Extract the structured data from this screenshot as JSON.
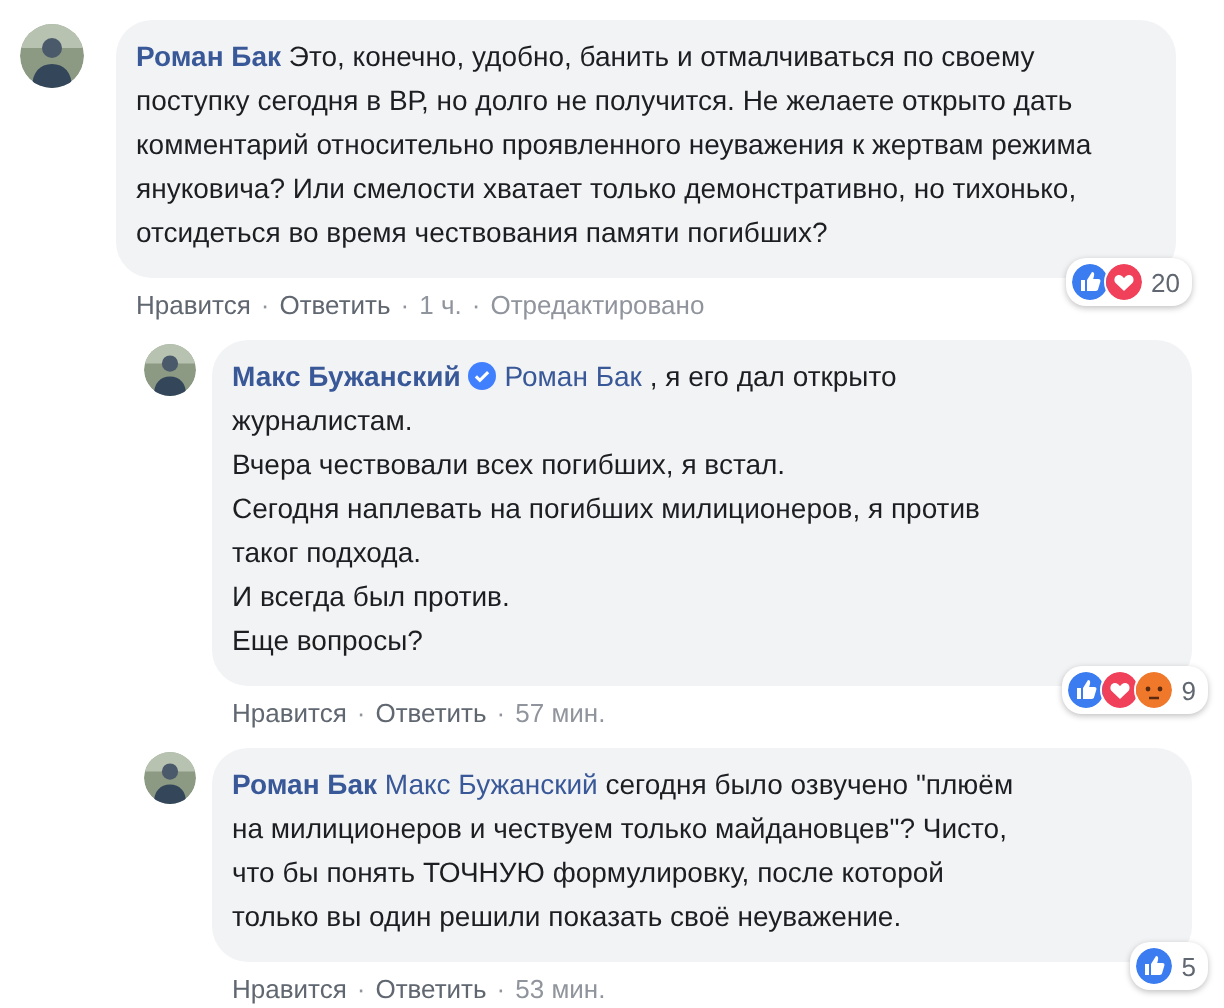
{
  "comments": [
    {
      "author": "Роман Бак",
      "verified": false,
      "text": "Это, конечно, удобно, банить и отмалчиваться по своему поступку сегодня в ВР, но долго не получится. Не желаете открыто дать комментарий относительно проявленного неуважения к жертвам режима януковича? Или смелости хватает только демонстративно, но тихонько, отсидеться во время чествования памяти погибших?",
      "reactions": [
        {
          "kind": "like"
        },
        {
          "kind": "love"
        }
      ],
      "reaction_count": "20",
      "actions": [
        {
          "kind": "link",
          "label": "Нравится"
        },
        {
          "kind": "sep",
          "label": "·"
        },
        {
          "kind": "link",
          "label": "Ответить"
        },
        {
          "kind": "sep",
          "label": "·"
        },
        {
          "kind": "time",
          "label": "1 ч."
        },
        {
          "kind": "sep",
          "label": "·"
        },
        {
          "kind": "time",
          "label": "Отредактировано"
        }
      ],
      "replies": [
        {
          "author": "Макс Бужанский",
          "verified": true,
          "mention": "Роман Бак",
          "text": ", я его дал открыто журналистам.\nВчера чествовали всех погибших, я встал.\nСегодня наплевать на погибших милиционеров, я против таког подхода.\nИ всегда был против.\nЕще вопросы?",
          "reactions": [
            {
              "kind": "like"
            },
            {
              "kind": "love"
            },
            {
              "kind": "angry"
            }
          ],
          "reaction_count": "9",
          "actions": [
            {
              "kind": "link",
              "label": "Нравится"
            },
            {
              "kind": "sep",
              "label": "·"
            },
            {
              "kind": "link",
              "label": "Ответить"
            },
            {
              "kind": "sep",
              "label": "·"
            },
            {
              "kind": "time",
              "label": "57 мин."
            }
          ]
        },
        {
          "author": "Роман Бак",
          "verified": false,
          "mention": "Макс Бужанский",
          "text": "сегодня было озвучено \"плюём на милиционеров и чествуем только майдановцев\"? Чисто, что бы понять ТОЧНУЮ формулировку, после которой только вы один решили показать своё неуважение.",
          "reactions": [
            {
              "kind": "like"
            }
          ],
          "reaction_count": "5",
          "actions": [
            {
              "kind": "link",
              "label": "Нравится"
            },
            {
              "kind": "sep",
              "label": "·"
            },
            {
              "kind": "link",
              "label": "Ответить"
            },
            {
              "kind": "sep",
              "label": "·"
            },
            {
              "kind": "time",
              "label": "53 мин."
            }
          ]
        }
      ]
    }
  ]
}
